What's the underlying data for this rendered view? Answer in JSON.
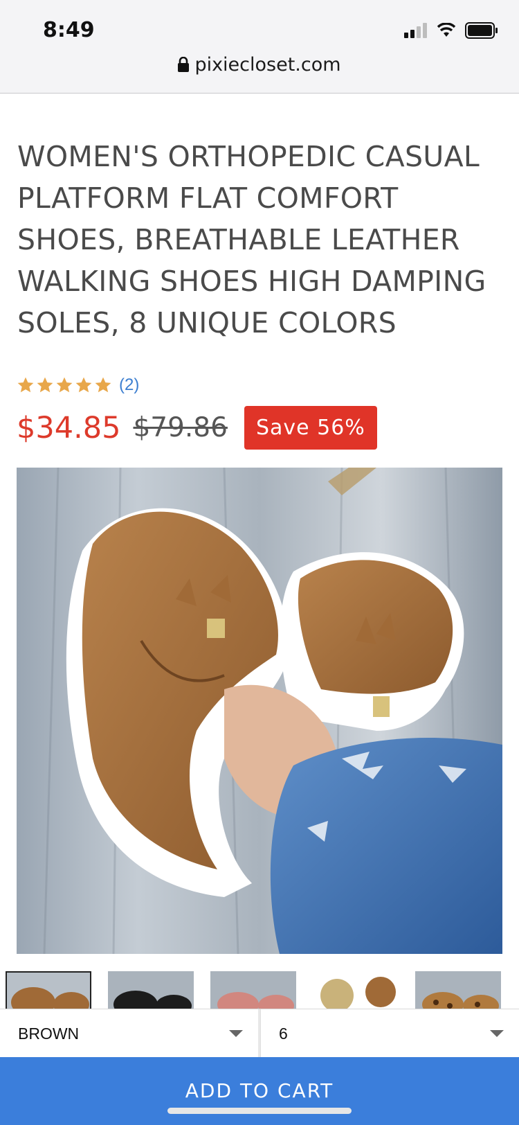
{
  "status_bar": {
    "time": "8:49"
  },
  "browser": {
    "url": "pixiecloset.com"
  },
  "product": {
    "title": "WOMEN'S ORTHOPEDIC CASUAL PLATFORM FLAT COMFORT SHOES, BREATHABLE LEATHER WALKING SHOES HIGH DAMPING SOLES, 8 UNIQUE COLORS",
    "rating_stars": 5,
    "review_count": "(2)",
    "price": "$34.85",
    "original_price": "$79.86",
    "save_label": "Save 56%"
  },
  "options": {
    "color": "BROWN",
    "size": "6"
  },
  "cart": {
    "button_label": "ADD TO CART"
  },
  "colors": {
    "accent": "#3b7edb",
    "price": "#dd3a2b",
    "badge": "#e03428",
    "star": "#e8a74a"
  },
  "icons": [
    "lock-icon",
    "signal-icon",
    "wifi-icon",
    "battery-icon",
    "star-icon",
    "chevron-down-icon"
  ]
}
